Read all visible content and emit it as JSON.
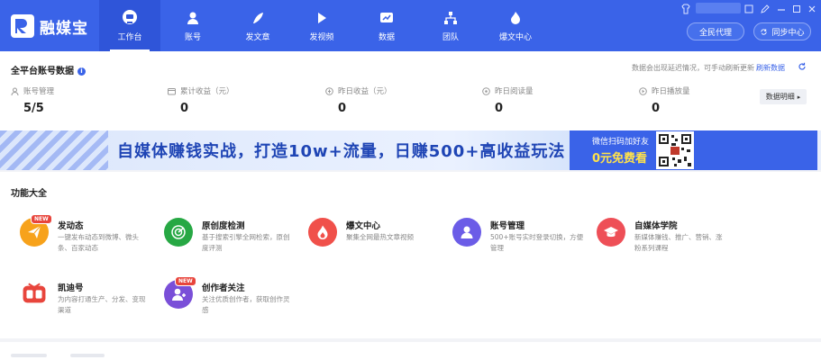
{
  "app": {
    "name": "融媒宝",
    "colors": {
      "brand": "#3a63e8",
      "cta": "#ffe24a",
      "accent_red": "#e8453c"
    }
  },
  "nav": {
    "items": [
      {
        "label": "工作台",
        "icon": "monitor-icon",
        "active": true
      },
      {
        "label": "账号",
        "icon": "user-icon"
      },
      {
        "label": "发文章",
        "icon": "feather-icon"
      },
      {
        "label": "发视频",
        "icon": "play-icon"
      },
      {
        "label": "数据",
        "icon": "chart-icon"
      },
      {
        "label": "团队",
        "icon": "team-icon"
      },
      {
        "label": "爆文中心",
        "icon": "fire-icon"
      }
    ]
  },
  "topright": {
    "agent_button": "全民代理",
    "sync_button": "同步中心"
  },
  "stats": {
    "title": "全平台账号数据",
    "hint": "数据会出现延迟情况，可手动刷新更新",
    "refresh_label": "刷新数据",
    "detail_button": "数据明细",
    "items": [
      {
        "label": "账号管理",
        "value": "5/5",
        "icon": "person-icon"
      },
      {
        "label": "累计收益（元）",
        "value": "0",
        "icon": "wallet-icon"
      },
      {
        "label": "昨日收益（元）",
        "value": "0",
        "icon": "coin-icon"
      },
      {
        "label": "昨日阅读量",
        "value": "0",
        "icon": "eye-icon"
      },
      {
        "label": "昨日播放量",
        "value": "0",
        "icon": "play-circle-icon"
      }
    ]
  },
  "banner": {
    "slogan": "自媒体赚钱实战，打造10w+流量，日赚500+高收益玩法",
    "sub": "微信扫码加好友",
    "cta": "0元免费看"
  },
  "features": {
    "title": "功能大全",
    "items": [
      {
        "title": "发动态",
        "desc": "一键发布动态到微博、微头条、百家动态",
        "color": "#f7a21b",
        "icon": "send-icon",
        "badge": "NEW"
      },
      {
        "title": "原创度检测",
        "desc": "基于搜索引擎全网检索，原创度评测",
        "color": "#27a844",
        "icon": "radar-icon",
        "badge": ""
      },
      {
        "title": "爆文中心",
        "desc": "聚集全网最热文章视频",
        "color": "#f0504a",
        "icon": "fire-icon",
        "badge": ""
      },
      {
        "title": "账号管理",
        "desc": "500+账号实时登录切换，方便管理",
        "color": "#6b5ce7",
        "icon": "user-icon",
        "badge": ""
      },
      {
        "title": "自媒体学院",
        "desc": "新媒体赚钱、推广、营销、涨粉系列课程",
        "color": "#ee4f57",
        "icon": "graduation-cap-icon",
        "badge": ""
      },
      {
        "title": "凯迪号",
        "desc": "为内容打通生产、分发、变现渠道",
        "color": "#ffffff",
        "icon": "kaidi-logo-icon",
        "badge": ""
      },
      {
        "title": "创作者关注",
        "desc": "关注优质创作者，获取创作灵感",
        "color": "#7a4fd8",
        "icon": "user-plus-icon",
        "badge": "NEW"
      }
    ]
  }
}
